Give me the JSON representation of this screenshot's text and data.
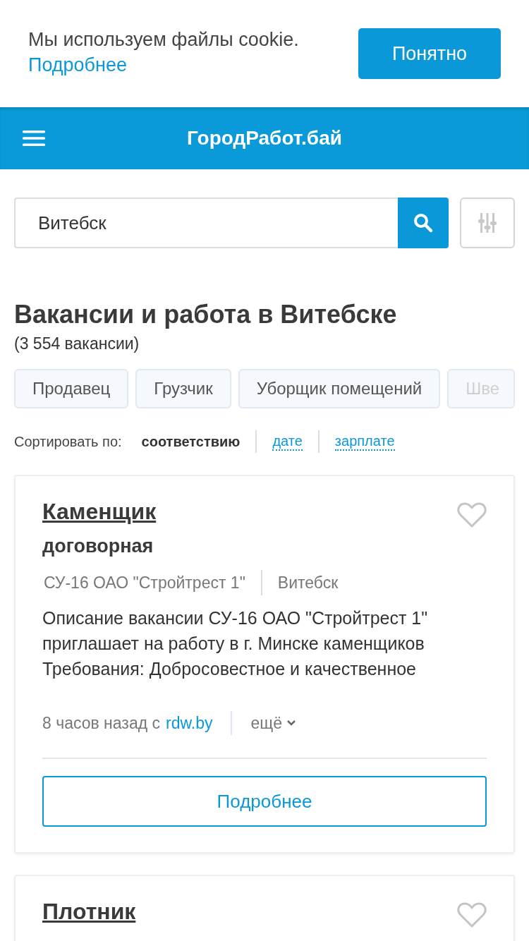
{
  "cookie_banner": {
    "text": "Мы используем файлы cookie.",
    "link": "Подробнее",
    "button": "Понятно"
  },
  "header": {
    "logo": "ГородРабот.бай"
  },
  "search": {
    "value": "Витебск"
  },
  "heading": {
    "title": "Вакансии и работа в Витебске",
    "count": "(3 554 вакансии)"
  },
  "chips": [
    {
      "label": "Продавец",
      "faded": false
    },
    {
      "label": "Грузчик",
      "faded": false
    },
    {
      "label": "Уборщик помещений",
      "faded": false
    },
    {
      "label": "Шве",
      "faded": true
    }
  ],
  "sort": {
    "label": "Сортировать по:",
    "options": [
      {
        "label": "соответствию",
        "selected": true
      },
      {
        "label": "дате",
        "selected": false
      },
      {
        "label": "зарплате",
        "selected": false
      }
    ]
  },
  "vacancies": [
    {
      "title": "Каменщик",
      "salary": "договорная",
      "company": "СУ-16 ОАО \"Стройтрест 1\"",
      "city": "Витебск",
      "description": "Описание вакансии СУ-16 ОАО \"Стройтрест 1\" приглашает на работу в г. Минске каменщиков Требования: Добросовестное и качественное",
      "time": "8 часов назад с",
      "source": "rdw.by",
      "more": "ещё",
      "button": "Подробнее",
      "favorite": false
    },
    {
      "title": "Плотник",
      "favorite": false
    }
  ]
}
